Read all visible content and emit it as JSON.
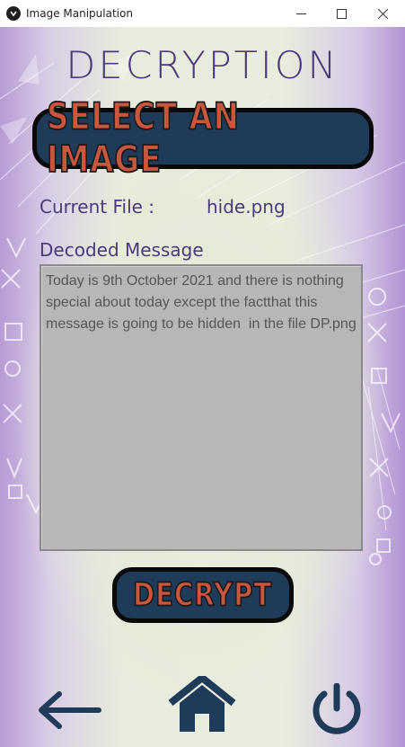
{
  "window": {
    "title": "Image Manipulation",
    "icons": {
      "app": "app-logo-icon",
      "minimize": "minimize-icon",
      "maximize": "maximize-icon",
      "close": "close-icon"
    }
  },
  "screen": {
    "heading": "DECRYPTION",
    "select_button_label": "SELECT AN IMAGE",
    "current_file_label": "Current File :",
    "current_file_name": "hide.png",
    "decoded_label": "Decoded Message",
    "decoded_message": "Today is 9th October 2021 and there is nothing special about today except the factthat this message is going to be hidden  in the file DP.png",
    "decrypt_button_label": "DECRYPT"
  },
  "nav": {
    "back_icon": "arrow-left-icon",
    "home_icon": "home-icon",
    "power_icon": "power-icon"
  },
  "colors": {
    "heading": "#4b3a7a",
    "button_fill": "#1f3b5a",
    "button_text": "#c8573e",
    "button_border": "#0a0a0a",
    "textbox_bg": "#b7b7b7",
    "textbox_text": "#555555",
    "nav_icons": "#1f3b5a"
  }
}
